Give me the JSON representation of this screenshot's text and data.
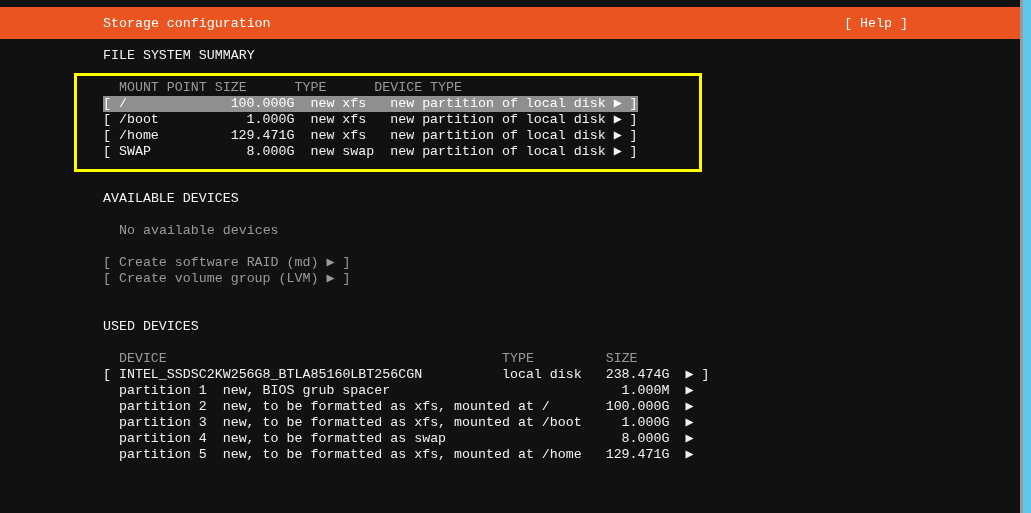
{
  "header": {
    "title": "Storage configuration",
    "help": "[ Help ]"
  },
  "file_system_summary": {
    "heading": "FILE SYSTEM SUMMARY",
    "columns": [
      "MOUNT POINT",
      "SIZE",
      "TYPE",
      "DEVICE TYPE"
    ],
    "rows": [
      {
        "open": "[",
        "mount_point": "/",
        "size": "100.000G",
        "type": "new xfs",
        "device_type": "new partition of local disk",
        "arrow": "▶",
        "close": "]",
        "selected": true
      },
      {
        "open": "[",
        "mount_point": "/boot",
        "size": "1.000G",
        "type": "new xfs",
        "device_type": "new partition of local disk",
        "arrow": "▶",
        "close": "]",
        "selected": false
      },
      {
        "open": "[",
        "mount_point": "/home",
        "size": "129.471G",
        "type": "new xfs",
        "device_type": "new partition of local disk",
        "arrow": "▶",
        "close": "]",
        "selected": false
      },
      {
        "open": "[",
        "mount_point": "SWAP",
        "size": "8.000G",
        "type": "new swap",
        "device_type": "new partition of local disk",
        "arrow": "▶",
        "close": "]",
        "selected": false
      }
    ]
  },
  "available_devices": {
    "heading": "AVAILABLE DEVICES",
    "message": "No available devices",
    "actions": [
      {
        "label": "[ Create software RAID (md) ▶ ]",
        "disabled": true
      },
      {
        "label": "[ Create volume group (LVM) ▶ ]",
        "disabled": true
      }
    ]
  },
  "used_devices": {
    "heading": "USED DEVICES",
    "columns": [
      "DEVICE",
      "TYPE",
      "SIZE"
    ],
    "disk": {
      "open": "[",
      "device": "INTEL_SSDSC2KW256G8_BTLA85160LBT256CGN",
      "type": "local disk",
      "size": "238.474G",
      "arrow": "▶",
      "close": "]"
    },
    "partitions": [
      {
        "name": "partition 1",
        "description": "new, BIOS grub spacer",
        "size": "1.000M",
        "arrow": "▶"
      },
      {
        "name": "partition 2",
        "description": "new, to be formatted as xfs, mounted at /",
        "size": "100.000G",
        "arrow": "▶"
      },
      {
        "name": "partition 3",
        "description": "new, to be formatted as xfs, mounted at /boot",
        "size": "1.000G",
        "arrow": "▶"
      },
      {
        "name": "partition 4",
        "description": "new, to be formatted as swap",
        "size": "8.000G",
        "arrow": "▶"
      },
      {
        "name": "partition 5",
        "description": "new, to be formatted as xfs, mounted at /home",
        "size": "129.471G",
        "arrow": "▶"
      }
    ]
  }
}
